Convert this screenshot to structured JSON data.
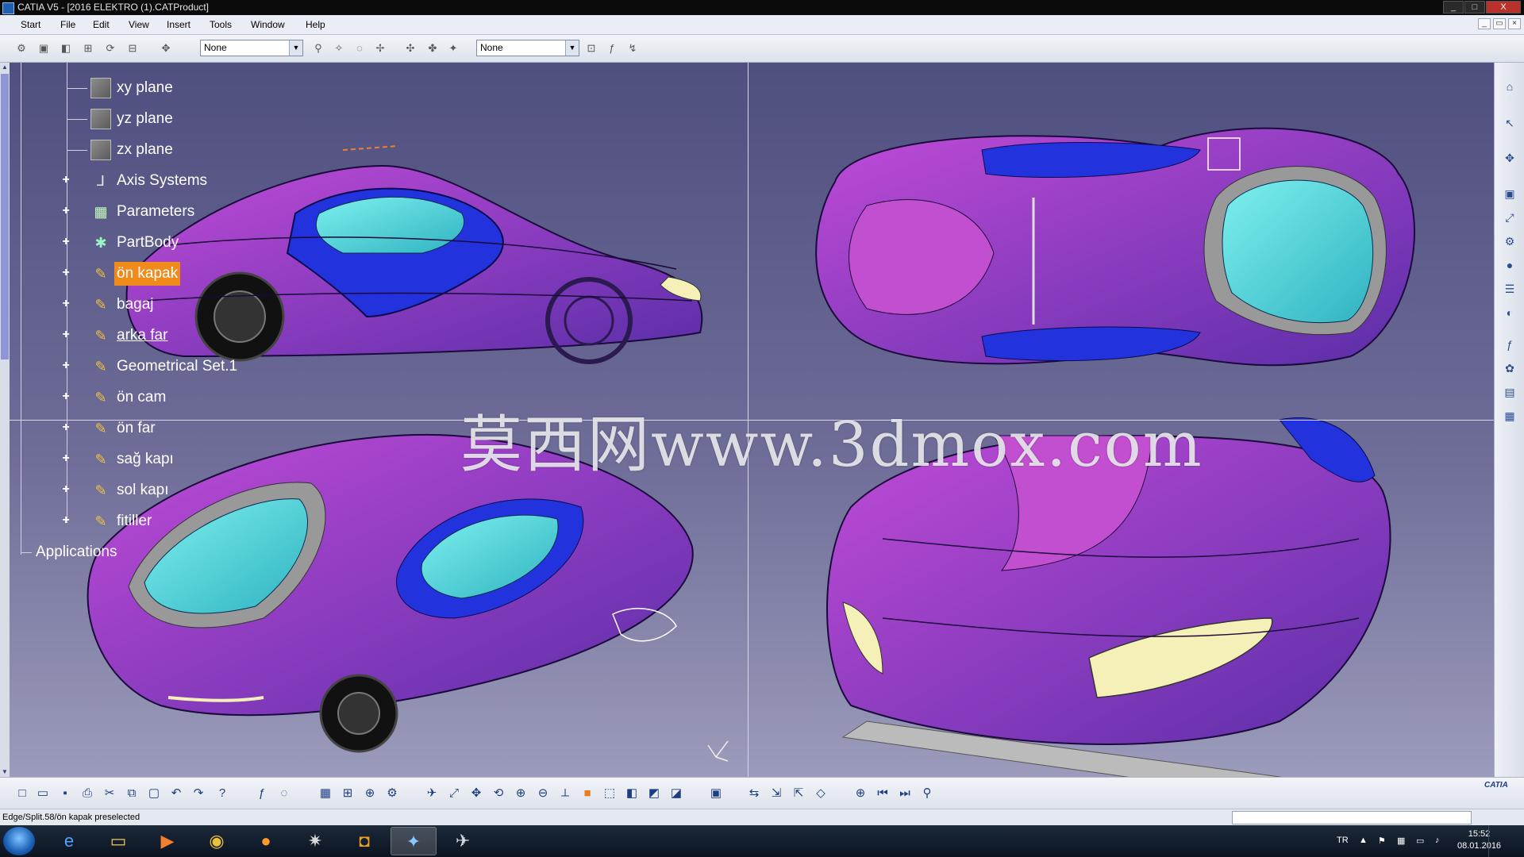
{
  "window": {
    "title": "CATIA V5 - [2016 ELEKTRO (1).CATProduct]",
    "min_label": "_",
    "max_label": "□",
    "close_label": "X"
  },
  "menu": {
    "items": [
      "Start",
      "File",
      "Edit",
      "View",
      "Insert",
      "Tools",
      "Window",
      "Help"
    ]
  },
  "toolbar": {
    "dropdown1_value": "None",
    "dropdown2_value": "None"
  },
  "tree": {
    "nodes": [
      {
        "label": "xy plane",
        "icon": "plane-icon"
      },
      {
        "label": "yz plane",
        "icon": "plane-icon"
      },
      {
        "label": "zx plane",
        "icon": "plane-icon"
      },
      {
        "label": "Axis Systems",
        "icon": "axis-system-icon"
      },
      {
        "label": "Parameters",
        "icon": "parameters-icon"
      },
      {
        "label": "PartBody",
        "icon": "partbody-icon"
      },
      {
        "label": "ön kapak",
        "icon": "geometrical-set-icon",
        "selected": true
      },
      {
        "label": "bagaj",
        "icon": "geometrical-set-icon"
      },
      {
        "label": "arka far",
        "icon": "geometrical-set-icon"
      },
      {
        "label": "Geometrical Set.1",
        "icon": "geometrical-set-icon"
      },
      {
        "label": "ön cam",
        "icon": "geometrical-set-icon"
      },
      {
        "label": "ön far",
        "icon": "geometrical-set-icon"
      },
      {
        "label": "sağ kapı",
        "icon": "geometrical-set-icon"
      },
      {
        "label": "sol kapı",
        "icon": "geometrical-set-icon"
      },
      {
        "label": "fitiller",
        "icon": "geometrical-set-icon"
      }
    ],
    "applications_label": "Applications"
  },
  "watermark": "莫西网www.3dmox.com",
  "status": {
    "message": "Edge/Split.58/ön kapak preselected"
  },
  "taskbar": {
    "language": "TR",
    "time": "15:52",
    "date": "08.01.2016"
  },
  "colors": {
    "viewport_top": "#4f4f80",
    "viewport_bottom": "#9b9bbb",
    "selection": "#f08a1a",
    "car_body": "#7a3fc4",
    "car_blue": "#2233dd",
    "glass": "#47d6d6"
  }
}
